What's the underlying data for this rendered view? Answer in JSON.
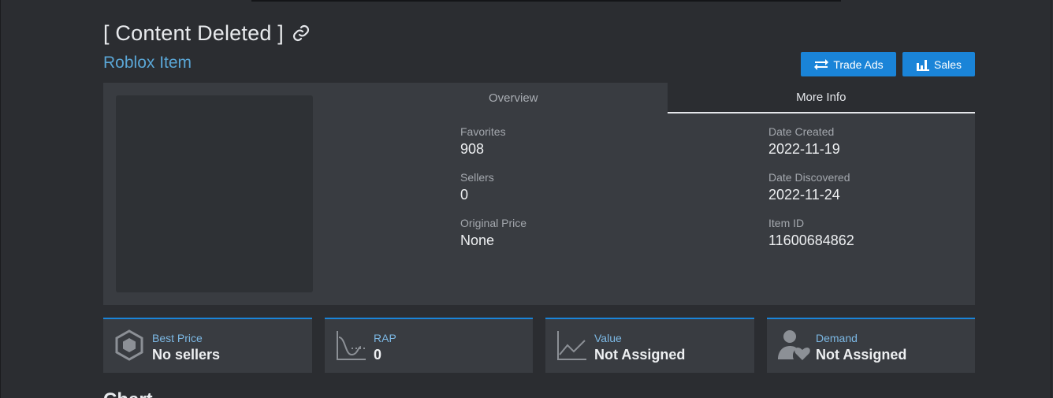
{
  "header": {
    "title": "[ Content Deleted ]",
    "subtitle": "Roblox Item"
  },
  "buttons": {
    "trade_ads": "Trade Ads",
    "sales": "Sales"
  },
  "tabs": [
    {
      "label": "Overview",
      "active": false
    },
    {
      "label": "More Info",
      "active": true
    }
  ],
  "info_left": [
    {
      "label": "Favorites",
      "value": "908"
    },
    {
      "label": "Sellers",
      "value": "0"
    },
    {
      "label": "Original Price",
      "value": "None"
    }
  ],
  "info_right": [
    {
      "label": "Date Created",
      "value": "2022-11-19"
    },
    {
      "label": "Date Discovered",
      "value": "2022-11-24"
    },
    {
      "label": "Item ID",
      "value": "11600684862"
    }
  ],
  "stats": [
    {
      "label": "Best Price",
      "value": "No sellers",
      "icon": "hexagon-icon"
    },
    {
      "label": "RAP",
      "value": "0",
      "icon": "rap-curve-icon"
    },
    {
      "label": "Value",
      "value": "Not Assigned",
      "icon": "line-chart-icon"
    },
    {
      "label": "Demand",
      "value": "Not Assigned",
      "icon": "user-heart-icon"
    }
  ],
  "section_heading": "Chart",
  "colors": {
    "accent": "#1a84d8",
    "link": "#5aa6d6",
    "panel": "#393c41",
    "background": "#2b2d31"
  }
}
